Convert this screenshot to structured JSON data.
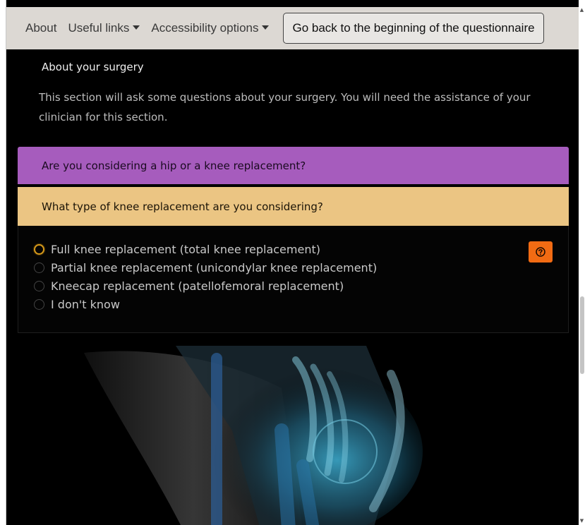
{
  "nav": {
    "about": "About",
    "useful_links": "Useful links",
    "accessibility": "Accessibility options",
    "back_button": "Go back to the beginning of the questionnaire"
  },
  "section": {
    "title": "About your surgery",
    "description": "This section will ask some questions about your surgery. You will need the assistance of your clinician for this section."
  },
  "question1": {
    "text": "Are you considering a hip or a knee replacement?",
    "color": "#a65cbd"
  },
  "question2": {
    "text": "What type of knee replacement are you considering?",
    "color": "#ebc583",
    "options": [
      "Full knee replacement (total knee replacement)",
      "Partial knee replacement (unicondylar knee replacement)",
      "Kneecap replacement (patellofemoral replacement)",
      "I don't know"
    ],
    "help_icon": "question-mark-icon",
    "help_color": "#f26b13"
  },
  "hero": {
    "icon": "knee-xray-illustration"
  }
}
